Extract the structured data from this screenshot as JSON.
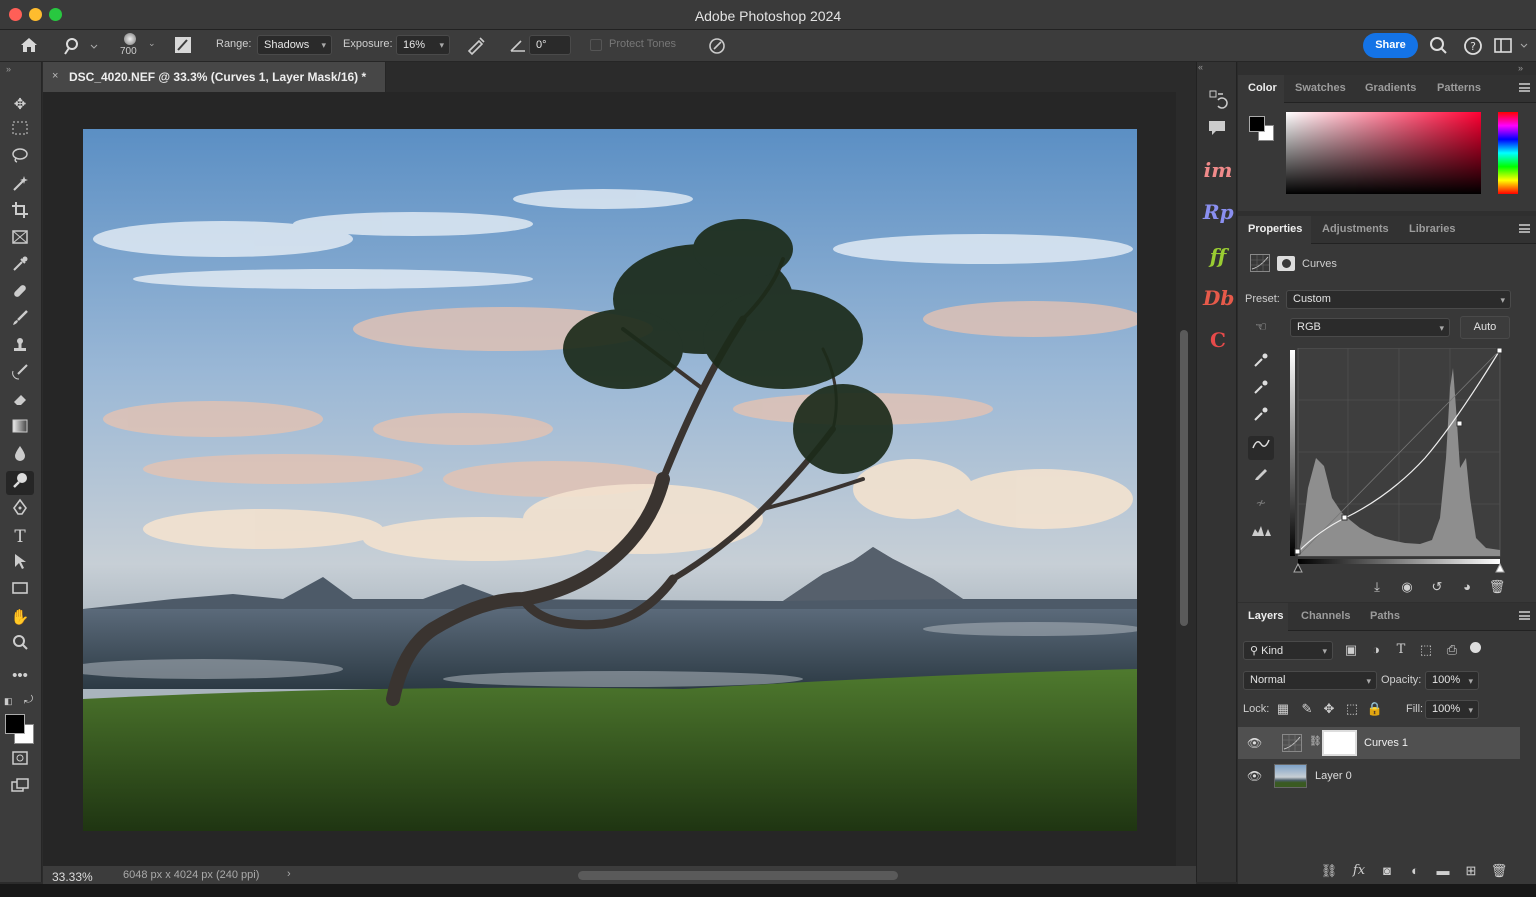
{
  "window": {
    "title": "Adobe Photoshop 2024"
  },
  "options_bar": {
    "brush_size": "700",
    "range_label": "Range:",
    "range_value": "Shadows",
    "exposure_label": "Exposure:",
    "exposure_value": "16%",
    "angle_value": "0°",
    "protect_tones_label": "Protect Tones",
    "share_label": "Share"
  },
  "document": {
    "tab_title": "DSC_4020.NEF @ 33.3% (Curves 1, Layer Mask/16) *",
    "zoom": "33.33%",
    "info": "6048 px x 4024 px (240 ppi)"
  },
  "plugins": [
    {
      "name": "im",
      "color": "#f08a8a"
    },
    {
      "name": "Rp",
      "color": "#8a8ff0"
    },
    {
      "name": "ff",
      "color": "#9acd32"
    },
    {
      "name": "Db",
      "color": "#e75a4a"
    },
    {
      "name": "C",
      "color": "#e74a4a"
    }
  ],
  "color_panel": {
    "tabs": [
      "Color",
      "Swatches",
      "Gradients",
      "Patterns"
    ],
    "active_tab": "Color",
    "foreground": "#000000",
    "background": "#ffffff",
    "hue": "#ff0033"
  },
  "properties_panel": {
    "tabs": [
      "Properties",
      "Adjustments",
      "Libraries"
    ],
    "active_tab": "Properties",
    "type_label": "Curves",
    "preset_label": "Preset:",
    "preset_value": "Custom",
    "channel_value": "RGB",
    "auto_label": "Auto"
  },
  "layers_panel": {
    "tabs": [
      "Layers",
      "Channels",
      "Paths"
    ],
    "active_tab": "Layers",
    "filter_kind": "Kind",
    "blend_mode": "Normal",
    "opacity_label": "Opacity:",
    "opacity_value": "100%",
    "lock_label": "Lock:",
    "fill_label": "Fill:",
    "fill_value": "100%",
    "layers": [
      {
        "name": "Curves 1",
        "selected": true
      },
      {
        "name": "Layer 0",
        "selected": false
      }
    ]
  }
}
